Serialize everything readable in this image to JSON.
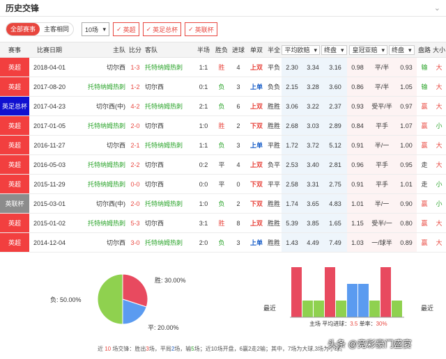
{
  "page": {
    "title": "历史交锋"
  },
  "filters": {
    "seg_all": "全部赛事",
    "seg_home": "主客相同",
    "count_select": "10场",
    "leagues": [
      "英超",
      "英足总杯",
      "英联杯"
    ]
  },
  "table": {
    "headers": {
      "league": "赛事",
      "date": "比赛日期",
      "home": "主队",
      "score": "比分",
      "away": "客队",
      "half": "半场",
      "result": "胜负",
      "goals": "进球",
      "oddeven": "单双",
      "halffull": "半全",
      "euro_sel": "平均欧赔",
      "final1": "终盘",
      "crown_sel": "皇冠亚赔",
      "final2": "终盘",
      "pan": "盘路",
      "size": "大小"
    },
    "rows": [
      {
        "league": "英超",
        "lc": "#f23f3f",
        "date": "2018-04-01",
        "home": "切尔西",
        "hc": "#333333",
        "score": "1-3",
        "away": "托特纳姆热刺",
        "ac": "#29a329",
        "half": "1:1",
        "result": "胜",
        "rc": "#e8463e",
        "goals": "4",
        "oe": "上双",
        "oec": "#e8463e",
        "hf": "平负",
        "e1": "2.30",
        "e2": "3.34",
        "e3": "3.16",
        "c1": "0.98",
        "c2": "平/半",
        "c3": "0.93",
        "pan": "输",
        "pc": "#29a329",
        "size": "大",
        "sc": "#e8463e"
      },
      {
        "league": "英超",
        "lc": "#f23f3f",
        "date": "2017-08-20",
        "home": "托特纳姆热刺",
        "hc": "#29a329",
        "score": "1-2",
        "away": "切尔西",
        "ac": "#333333",
        "half": "0:1",
        "result": "负",
        "rc": "#29a329",
        "goals": "3",
        "oe": "上单",
        "oec": "#1a5fc8",
        "hf": "负负",
        "e1": "2.15",
        "e2": "3.28",
        "e3": "3.60",
        "c1": "0.86",
        "c2": "平/半",
        "c3": "1.05",
        "pan": "输",
        "pc": "#29a329",
        "size": "大",
        "sc": "#e8463e"
      },
      {
        "league": "英足总杯",
        "lc": "#1010d0",
        "date": "2017-04-23",
        "home": "切尔西(中)",
        "hc": "#333333",
        "score": "4-2",
        "away": "托特纳姆热刺",
        "ac": "#29a329",
        "half": "2:1",
        "result": "负",
        "rc": "#29a329",
        "goals": "6",
        "oe": "上双",
        "oec": "#e8463e",
        "hf": "胜胜",
        "e1": "3.06",
        "e2": "3.22",
        "e3": "2.37",
        "c1": "0.93",
        "c2": "受平/半",
        "c3": "0.97",
        "pan": "赢",
        "pc": "#e8463e",
        "size": "大",
        "sc": "#e8463e"
      },
      {
        "league": "英超",
        "lc": "#f23f3f",
        "date": "2017-01-05",
        "home": "托特纳姆热刺",
        "hc": "#29a329",
        "score": "2-0",
        "away": "切尔西",
        "ac": "#333333",
        "half": "1:0",
        "result": "胜",
        "rc": "#e8463e",
        "goals": "2",
        "oe": "下双",
        "oec": "#e8463e",
        "hf": "胜胜",
        "e1": "2.68",
        "e2": "3.03",
        "e3": "2.89",
        "c1": "0.84",
        "c2": "平手",
        "c3": "1.07",
        "pan": "赢",
        "pc": "#e8463e",
        "size": "小",
        "sc": "#29a329"
      },
      {
        "league": "英超",
        "lc": "#f23f3f",
        "date": "2016-11-27",
        "home": "切尔西",
        "hc": "#333333",
        "score": "2-1",
        "away": "托特纳姆热刺",
        "ac": "#29a329",
        "half": "1:1",
        "result": "负",
        "rc": "#29a329",
        "goals": "3",
        "oe": "上单",
        "oec": "#1a5fc8",
        "hf": "平胜",
        "e1": "1.72",
        "e2": "3.72",
        "e3": "5.12",
        "c1": "0.91",
        "c2": "半/一",
        "c3": "1.00",
        "pan": "赢",
        "pc": "#e8463e",
        "size": "大",
        "sc": "#e8463e"
      },
      {
        "league": "英超",
        "lc": "#f23f3f",
        "date": "2016-05-03",
        "home": "托特纳姆热刺",
        "hc": "#29a329",
        "score": "2-2",
        "away": "切尔西",
        "ac": "#333333",
        "half": "0:2",
        "result": "平",
        "rc": "#333333",
        "goals": "4",
        "oe": "上双",
        "oec": "#e8463e",
        "hf": "负平",
        "e1": "2.53",
        "e2": "3.40",
        "e3": "2.81",
        "c1": "0.96",
        "c2": "平手",
        "c3": "0.95",
        "pan": "走",
        "pc": "#333333",
        "size": "大",
        "sc": "#e8463e"
      },
      {
        "league": "英超",
        "lc": "#f23f3f",
        "date": "2015-11-29",
        "home": "托特纳姆热刺",
        "hc": "#29a329",
        "score": "0-0",
        "away": "切尔西",
        "ac": "#333333",
        "half": "0:0",
        "result": "平",
        "rc": "#333333",
        "goals": "0",
        "oe": "下双",
        "oec": "#e8463e",
        "hf": "平平",
        "e1": "2.58",
        "e2": "3.31",
        "e3": "2.75",
        "c1": "0.91",
        "c2": "平手",
        "c3": "1.01",
        "pan": "走",
        "pc": "#333333",
        "size": "小",
        "sc": "#29a329"
      },
      {
        "league": "英联杯",
        "lc": "#8c8c8c",
        "date": "2015-03-01",
        "home": "切尔西(中)",
        "hc": "#333333",
        "score": "2-0",
        "away": "托特纳姆热刺",
        "ac": "#29a329",
        "half": "1:0",
        "result": "负",
        "rc": "#29a329",
        "goals": "2",
        "oe": "下双",
        "oec": "#e8463e",
        "hf": "胜胜",
        "e1": "1.74",
        "e2": "3.65",
        "e3": "4.83",
        "c1": "1.01",
        "c2": "半/一",
        "c3": "0.90",
        "pan": "赢",
        "pc": "#e8463e",
        "size": "小",
        "sc": "#29a329"
      },
      {
        "league": "英超",
        "lc": "#f23f3f",
        "date": "2015-01-02",
        "home": "托特纳姆热刺",
        "hc": "#29a329",
        "score": "5-3",
        "away": "切尔西",
        "ac": "#333333",
        "half": "3:1",
        "result": "胜",
        "rc": "#e8463e",
        "goals": "8",
        "oe": "上双",
        "oec": "#e8463e",
        "hf": "胜胜",
        "e1": "5.39",
        "e2": "3.85",
        "e3": "1.65",
        "c1": "1.15",
        "c2": "受半/一",
        "c3": "0.80",
        "pan": "赢",
        "pc": "#e8463e",
        "size": "大",
        "sc": "#e8463e"
      },
      {
        "league": "英超",
        "lc": "#f23f3f",
        "date": "2014-12-04",
        "home": "切尔西",
        "hc": "#333333",
        "score": "3-0",
        "away": "托特纳姆热刺",
        "ac": "#29a329",
        "half": "2:0",
        "result": "负",
        "rc": "#29a329",
        "goals": "3",
        "oe": "上单",
        "oec": "#1a5fc8",
        "hf": "胜胜",
        "e1": "1.43",
        "e2": "4.49",
        "e3": "7.49",
        "c1": "1.03",
        "c2": "一/球半",
        "c3": "0.89",
        "pan": "赢",
        "pc": "#e8463e",
        "size": "大",
        "sc": "#e8463e"
      }
    ]
  },
  "chart_data": [
    {
      "type": "pie",
      "slices": [
        {
          "name": "胜",
          "value": 30.0,
          "label": "胜: 30.00%",
          "color": "#e84a5f"
        },
        {
          "name": "平",
          "value": 20.0,
          "label": "平: 20.00%",
          "color": "#5b9bf0"
        },
        {
          "name": "负",
          "value": 50.0,
          "label": "负: 50.00%",
          "color": "#8fd14f"
        }
      ]
    },
    {
      "type": "bar",
      "left_label": "最近",
      "right_label": "最近",
      "values": [
        3,
        1,
        1,
        3,
        1,
        2,
        2,
        1,
        3,
        1
      ],
      "colors": [
        "#e84a5f",
        "#8fd14f",
        "#8fd14f",
        "#e84a5f",
        "#8fd14f",
        "#5b9bf0",
        "#5b9bf0",
        "#8fd14f",
        "#e84a5f",
        "#8fd14f"
      ],
      "footer": {
        "prefix": "主场  平均进球：",
        "avg": "3.5",
        "mid": "  单率：",
        "odd_rate": "30%"
      }
    }
  ],
  "summary": {
    "p1": "近 ",
    "n": "10",
    "p2": " 场交锋：胜出",
    "win": "3",
    "p3": "场，平局",
    "draw": "2",
    "p4": "场，输",
    "lose": "5",
    "p5": "场；近10场开盘，6赢2走2输；其中，7场为大球,3场为小球。"
  },
  "watermark": "头条 @竞彩豪门盛宴"
}
